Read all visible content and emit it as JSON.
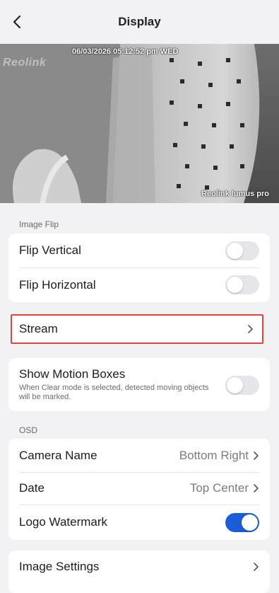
{
  "header": {
    "title": "Display"
  },
  "preview": {
    "timestamp": "06/03/2026 05:12:52 pm WED",
    "brand_watermark": "Reolink",
    "model_label": "Reolink lumus pro"
  },
  "image_flip": {
    "section_label": "Image Flip",
    "flip_vertical": {
      "label": "Flip Vertical",
      "enabled": false
    },
    "flip_horizontal": {
      "label": "Flip Horizontal",
      "enabled": false
    }
  },
  "stream": {
    "label": "Stream"
  },
  "motion": {
    "label": "Show Motion Boxes",
    "description": "When Clear mode is selected, detected moving objects will be marked.",
    "enabled": false
  },
  "osd": {
    "section_label": "OSD",
    "camera_name": {
      "label": "Camera Name",
      "value": "Bottom Right"
    },
    "date": {
      "label": "Date",
      "value": "Top Center"
    },
    "logo_watermark": {
      "label": "Logo Watermark",
      "enabled": true
    }
  },
  "image_settings": {
    "label": "Image Settings"
  },
  "colors": {
    "accent": "#1a5dd6",
    "highlight_border": "#e0453d",
    "background": "#f2f2f5"
  }
}
